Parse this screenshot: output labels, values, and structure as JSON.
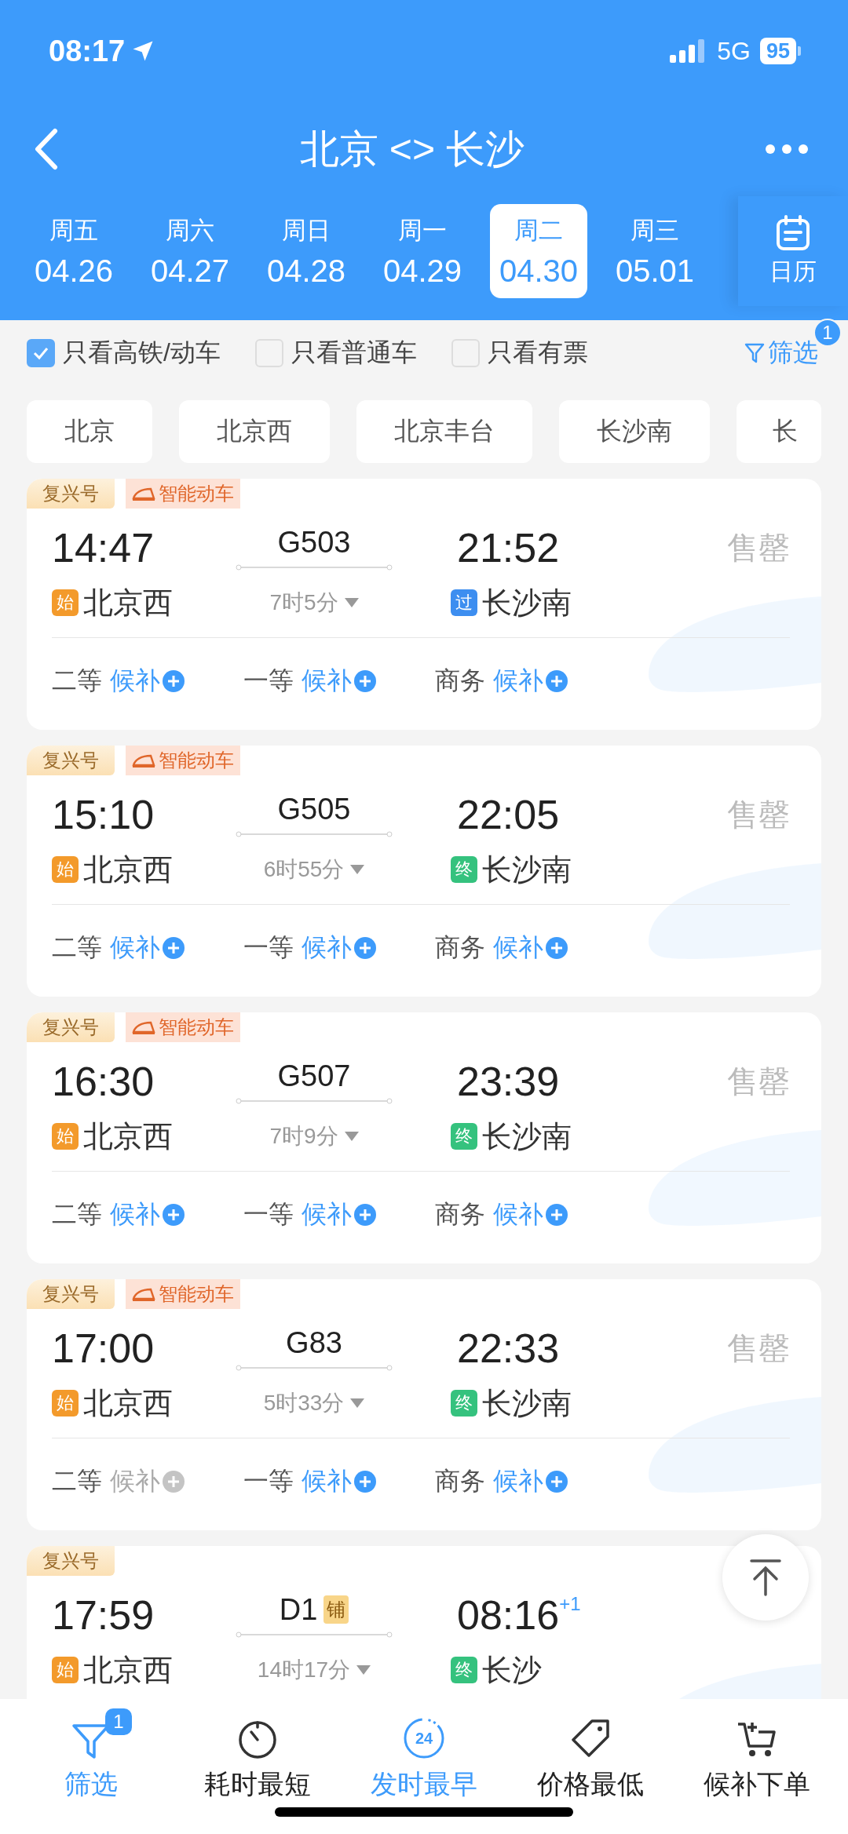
{
  "status_bar": {
    "time": "08:17",
    "network": "5G",
    "battery": "95"
  },
  "header": {
    "title": "北京 <> 长沙"
  },
  "dates": [
    {
      "weekday": "周五",
      "date": "04.26",
      "selected": false
    },
    {
      "weekday": "周六",
      "date": "04.27",
      "selected": false
    },
    {
      "weekday": "周日",
      "date": "04.28",
      "selected": false
    },
    {
      "weekday": "周一",
      "date": "04.29",
      "selected": false
    },
    {
      "weekday": "周二",
      "date": "04.30",
      "selected": true
    },
    {
      "weekday": "周三",
      "date": "05.01",
      "selected": false
    }
  ],
  "calendar_button": {
    "label": "日历"
  },
  "filters": [
    {
      "label": "只看高铁/动车",
      "checked": true
    },
    {
      "label": "只看普通车",
      "checked": false
    },
    {
      "label": "只看有票",
      "checked": false
    }
  ],
  "filter_button": {
    "label": "筛选",
    "badge": "1"
  },
  "stations": [
    "北京",
    "北京西",
    "北京丰台",
    "长沙南",
    "长"
  ],
  "trains": [
    {
      "tags": [
        {
          "kind": "fuxing",
          "label": "复兴号"
        },
        {
          "kind": "smart",
          "label": "智能动车"
        }
      ],
      "depart": "14:47",
      "train_no": "G503",
      "arrive": "21:52",
      "duration": "7时5分",
      "from": {
        "badge": "始",
        "color": "#f39a2b",
        "name": "北京西"
      },
      "to": {
        "badge": "过",
        "color": "#3d8ef0",
        "name": "长沙南"
      },
      "status": "售罄",
      "seats": [
        {
          "class": "二等",
          "status": "候补",
          "available": true
        },
        {
          "class": "一等",
          "status": "候补",
          "available": true
        },
        {
          "class": "商务",
          "status": "候补",
          "available": true
        }
      ]
    },
    {
      "tags": [
        {
          "kind": "fuxing",
          "label": "复兴号"
        },
        {
          "kind": "smart",
          "label": "智能动车"
        }
      ],
      "depart": "15:10",
      "train_no": "G505",
      "arrive": "22:05",
      "duration": "6时55分",
      "from": {
        "badge": "始",
        "color": "#f39a2b",
        "name": "北京西"
      },
      "to": {
        "badge": "终",
        "color": "#35c27e",
        "name": "长沙南"
      },
      "status": "售罄",
      "seats": [
        {
          "class": "二等",
          "status": "候补",
          "available": true
        },
        {
          "class": "一等",
          "status": "候补",
          "available": true
        },
        {
          "class": "商务",
          "status": "候补",
          "available": true
        }
      ]
    },
    {
      "tags": [
        {
          "kind": "fuxing",
          "label": "复兴号"
        },
        {
          "kind": "smart",
          "label": "智能动车"
        }
      ],
      "depart": "16:30",
      "train_no": "G507",
      "arrive": "23:39",
      "duration": "7时9分",
      "from": {
        "badge": "始",
        "color": "#f39a2b",
        "name": "北京西"
      },
      "to": {
        "badge": "终",
        "color": "#35c27e",
        "name": "长沙南"
      },
      "status": "售罄",
      "seats": [
        {
          "class": "二等",
          "status": "候补",
          "available": true
        },
        {
          "class": "一等",
          "status": "候补",
          "available": true
        },
        {
          "class": "商务",
          "status": "候补",
          "available": true
        }
      ]
    },
    {
      "tags": [
        {
          "kind": "fuxing",
          "label": "复兴号"
        },
        {
          "kind": "smart",
          "label": "智能动车"
        }
      ],
      "depart": "17:00",
      "train_no": "G83",
      "arrive": "22:33",
      "duration": "5时33分",
      "from": {
        "badge": "始",
        "color": "#f39a2b",
        "name": "北京西"
      },
      "to": {
        "badge": "终",
        "color": "#35c27e",
        "name": "长沙南"
      },
      "status": "售罄",
      "seats": [
        {
          "class": "二等",
          "status": "候补",
          "available": false
        },
        {
          "class": "一等",
          "status": "候补",
          "available": true
        },
        {
          "class": "商务",
          "status": "候补",
          "available": true
        }
      ]
    },
    {
      "tags": [
        {
          "kind": "fuxing",
          "label": "复兴号"
        }
      ],
      "depart": "17:59",
      "train_no": "D1",
      "berth_badge": "铺",
      "arrive": "08:16",
      "day_offset": "+1",
      "duration": "14时17分",
      "from": {
        "badge": "始",
        "color": "#f39a2b",
        "name": "北京西"
      },
      "to": {
        "badge": "终",
        "color": "#35c27e",
        "name": "长沙"
      }
    }
  ],
  "bottom_nav": [
    {
      "kind": "filter",
      "label": "筛选",
      "active": true,
      "badge": "1"
    },
    {
      "kind": "timer",
      "label": "耗时最短",
      "active": false
    },
    {
      "kind": "clock24",
      "label": "发时最早",
      "active": true,
      "icon_label": "24"
    },
    {
      "kind": "tag",
      "label": "价格最低",
      "active": false
    },
    {
      "kind": "cart",
      "label": "候补下单",
      "active": false
    }
  ]
}
